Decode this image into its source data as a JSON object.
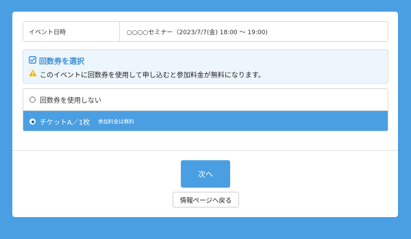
{
  "event_info": {
    "label": "イベント日時",
    "value": "○○○○セミナー（2023/7/7(金) 18:00 〜 19:00)"
  },
  "notice": {
    "title": "回数券を選択",
    "title_icon": "check-square-icon",
    "message": "このイベントに回数券を使用して申し込むと参加料金が無料になります。",
    "message_icon": "warning-icon",
    "accent_color": "#3d8fd6",
    "warning_color": "#f0b400"
  },
  "options": [
    {
      "label": "回数券を使用しない",
      "note": "",
      "selected": false
    },
    {
      "label": "チケットA／1枚",
      "note": "参加料金は無料",
      "selected": true
    }
  ],
  "buttons": {
    "next_label": "次へ",
    "back_label": "情報ページへ戻る"
  },
  "colors": {
    "background": "#4a9fe2",
    "primary": "#4a9fe2"
  }
}
